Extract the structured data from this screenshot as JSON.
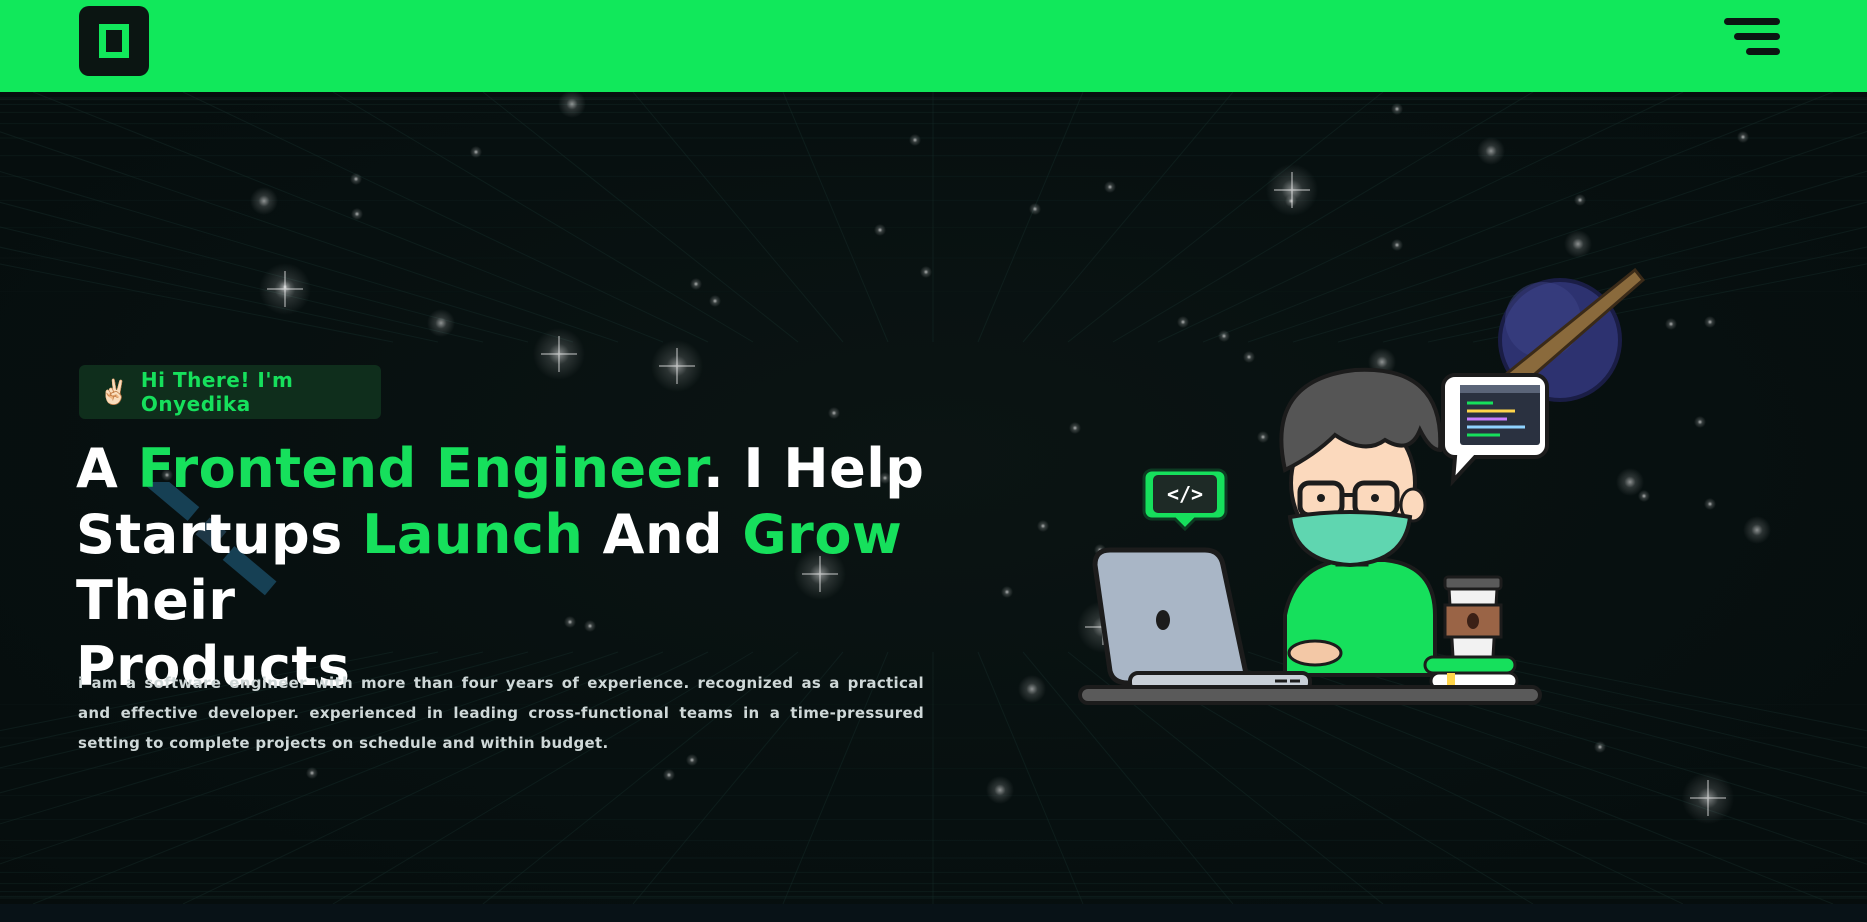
{
  "header": {
    "logo_icon": "bracket-logo-icon",
    "menu_icon": "hamburger-menu-icon",
    "accent_color": "#11e85b"
  },
  "hero": {
    "greeting_emoji": "✌🏻",
    "greeting_text": "Hi There! I'm Onyedika",
    "headline": {
      "w1": "A",
      "w2": "Frontend Engineer",
      "w3": ". I Help",
      "w4": "Startups",
      "w5": "Launch",
      "w6": "And",
      "w7": "Grow",
      "w8": "Their",
      "w9": "Products"
    },
    "bio": "i am a software engineer with more than four years of experience. recognized as a practical and effective developer. experienced in leading cross-functional teams in a time-pressured setting to complete projects on schedule and within budget."
  },
  "illustration": {
    "code_bubble_text": "</>",
    "coffee_icon": "coffee-bean-icon"
  }
}
